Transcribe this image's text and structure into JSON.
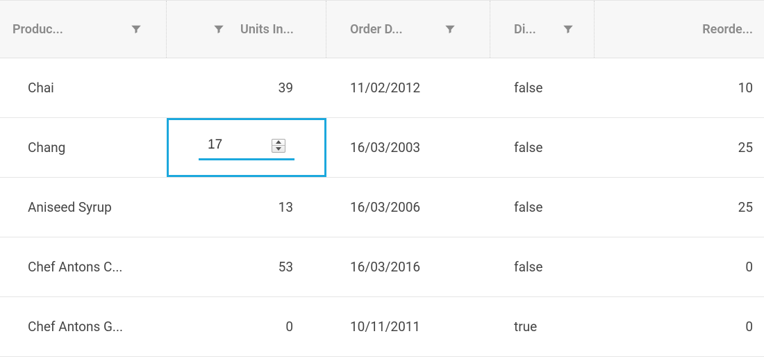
{
  "columns": {
    "product": "Produc...",
    "units": "Units In...",
    "order": "Order D...",
    "disc": "Di...",
    "reorder": "Reorde..."
  },
  "rows": [
    {
      "product": "Chai",
      "units": "39",
      "order": "11/02/2012",
      "disc": "false",
      "reorder": "10"
    },
    {
      "product": "Chang",
      "units": "17",
      "order": "16/03/2003",
      "disc": "false",
      "reorder": "25"
    },
    {
      "product": "Aniseed Syrup",
      "units": "13",
      "order": "16/03/2006",
      "disc": "false",
      "reorder": "25"
    },
    {
      "product": "Chef Antons C...",
      "units": "53",
      "order": "16/03/2016",
      "disc": "false",
      "reorder": "0"
    },
    {
      "product": "Chef Antons G...",
      "units": "0",
      "order": "10/11/2011",
      "disc": "true",
      "reorder": "0"
    }
  ],
  "editing": {
    "rowIndex": 1,
    "column": "units",
    "value": "17"
  },
  "colors": {
    "accent": "#1ca8dd"
  }
}
